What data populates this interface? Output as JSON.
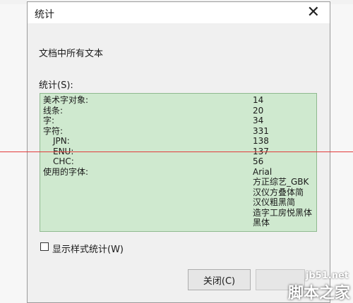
{
  "dialog": {
    "title": "统计",
    "document_label": "文档中所有文本",
    "stats_label": "统计(S):",
    "stats": [
      {
        "label": "美术字对象:",
        "value": "14"
      },
      {
        "label": "线条:",
        "value": "20"
      },
      {
        "label": "字:",
        "value": "34"
      },
      {
        "label": "字符:",
        "value": "331"
      },
      {
        "label": "JPN:",
        "value": "138"
      },
      {
        "label": "ENU:",
        "value": "137"
      },
      {
        "label": "CHC:",
        "value": "56"
      }
    ],
    "fonts_label": "使用的字体:",
    "fonts": [
      "Arial",
      "方正综艺_GBK",
      "汉仪方叠体简",
      "汉仪粗黑简",
      "造字工房悦黑体",
      "黑体"
    ],
    "checkbox_label": "显示样式统计(W)",
    "checkbox_checked": false,
    "close_button": "关闭(C)"
  },
  "watermark": {
    "url": "jb51.net",
    "name": "脚本之家"
  },
  "colors": {
    "stats_background": "#cfe9cf",
    "guide_line": "#e23a3a"
  }
}
